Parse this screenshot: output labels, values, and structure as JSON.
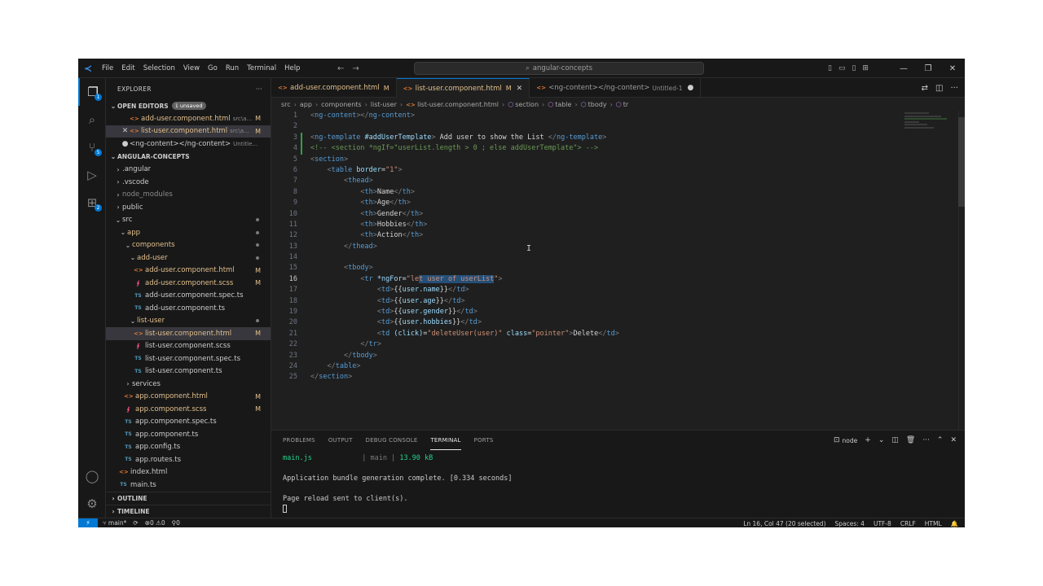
{
  "titlebar": {
    "menu": [
      "File",
      "Edit",
      "Selection",
      "View",
      "Go",
      "Run",
      "Terminal",
      "Help"
    ],
    "search_text": "angular-concepts"
  },
  "sidebar": {
    "title": "EXPLORER",
    "more": "···",
    "open_editors_label": "OPEN EDITORS",
    "unsaved_badge": "1 unsaved",
    "open_editors": [
      {
        "icon": "html",
        "name": "add-user.component.html",
        "desc": "src\\a...",
        "status": "M",
        "prefix": "none",
        "selected": false
      },
      {
        "icon": "html",
        "name": "list-user.component.html",
        "desc": "src\\a...",
        "status": "M",
        "prefix": "close",
        "selected": true
      },
      {
        "icon": "none",
        "name": "<ng-content></ng-content>",
        "desc": "Untitle...",
        "status": "",
        "prefix": "dot",
        "selected": false
      }
    ],
    "project_label": "ANGULAR-CONCEPTS",
    "tree": [
      {
        "depth": 0,
        "type": "folder",
        "open": false,
        "name": ".angular",
        "status": "",
        "mod": false,
        "selected": false
      },
      {
        "depth": 0,
        "type": "folder",
        "open": false,
        "name": ".vscode",
        "status": "",
        "mod": false,
        "selected": false
      },
      {
        "depth": 0,
        "type": "folder",
        "open": false,
        "name": "node_modules",
        "status": "",
        "mod": false,
        "selected": false,
        "dim": true
      },
      {
        "depth": 0,
        "type": "folder",
        "open": false,
        "name": "public",
        "status": "",
        "mod": false,
        "selected": false
      },
      {
        "depth": 0,
        "type": "folder",
        "open": true,
        "name": "src",
        "status": "dot",
        "mod": false,
        "selected": false
      },
      {
        "depth": 1,
        "type": "folder",
        "open": true,
        "name": "app",
        "status": "dot",
        "mod": true,
        "selected": false
      },
      {
        "depth": 2,
        "type": "folder",
        "open": true,
        "name": "components",
        "status": "dot",
        "mod": true,
        "selected": false
      },
      {
        "depth": 3,
        "type": "folder",
        "open": true,
        "name": "add-user",
        "status": "dot",
        "mod": true,
        "selected": false
      },
      {
        "depth": 4,
        "type": "html",
        "name": "add-user.component.html",
        "status": "M",
        "mod": true,
        "selected": false
      },
      {
        "depth": 4,
        "type": "scss",
        "name": "add-user.component.scss",
        "status": "M",
        "mod": true,
        "selected": false
      },
      {
        "depth": 4,
        "type": "ts",
        "name": "add-user.component.spec.ts",
        "status": "",
        "mod": false,
        "selected": false
      },
      {
        "depth": 4,
        "type": "ts",
        "name": "add-user.component.ts",
        "status": "",
        "mod": false,
        "selected": false
      },
      {
        "depth": 3,
        "type": "folder",
        "open": true,
        "name": "list-user",
        "status": "dot",
        "mod": true,
        "selected": false
      },
      {
        "depth": 4,
        "type": "html",
        "name": "list-user.component.html",
        "status": "M",
        "mod": true,
        "selected": true
      },
      {
        "depth": 4,
        "type": "scss",
        "name": "list-user.component.scss",
        "status": "",
        "mod": false,
        "selected": false
      },
      {
        "depth": 4,
        "type": "ts",
        "name": "list-user.component.spec.ts",
        "status": "",
        "mod": false,
        "selected": false
      },
      {
        "depth": 4,
        "type": "ts",
        "name": "list-user.component.ts",
        "status": "",
        "mod": false,
        "selected": false
      },
      {
        "depth": 2,
        "type": "folder",
        "open": false,
        "name": "services",
        "status": "",
        "mod": false,
        "selected": false
      },
      {
        "depth": 2,
        "type": "html",
        "name": "app.component.html",
        "status": "M",
        "mod": true,
        "selected": false
      },
      {
        "depth": 2,
        "type": "scss",
        "name": "app.component.scss",
        "status": "M",
        "mod": true,
        "selected": false
      },
      {
        "depth": 2,
        "type": "ts",
        "name": "app.component.spec.ts",
        "status": "",
        "mod": false,
        "selected": false
      },
      {
        "depth": 2,
        "type": "ts",
        "name": "app.component.ts",
        "status": "",
        "mod": false,
        "selected": false
      },
      {
        "depth": 2,
        "type": "ts",
        "name": "app.config.ts",
        "status": "",
        "mod": false,
        "selected": false
      },
      {
        "depth": 2,
        "type": "ts",
        "name": "app.routes.ts",
        "status": "",
        "mod": false,
        "selected": false
      },
      {
        "depth": 1,
        "type": "html",
        "name": "index.html",
        "status": "",
        "mod": false,
        "selected": false
      },
      {
        "depth": 1,
        "type": "ts",
        "name": "main.ts",
        "status": "",
        "mod": false,
        "selected": false
      }
    ],
    "outline_label": "OUTLINE",
    "timeline_label": "TIMELINE"
  },
  "tabs": [
    {
      "name": "add-user.component.html",
      "status": "M",
      "active": false,
      "modified": true,
      "desc": "",
      "end": "none"
    },
    {
      "name": "list-user.component.html",
      "status": "M",
      "active": true,
      "modified": true,
      "desc": "",
      "end": "close"
    },
    {
      "name": "<ng-content></ng-content>",
      "status": "",
      "active": false,
      "modified": false,
      "desc": "Untitled-1",
      "end": "dot"
    }
  ],
  "breadcrumb": [
    "src",
    "app",
    "components",
    "list-user",
    "list-user.component.html",
    "section",
    "table",
    "tbody",
    "tr"
  ],
  "editor": {
    "active_line": 16,
    "code": [
      [
        {
          "c": "t",
          "s": "<"
        },
        {
          "c": "tn",
          "s": "ng-content"
        },
        {
          "c": "t",
          "s": "></"
        },
        {
          "c": "tn",
          "s": "ng-content"
        },
        {
          "c": "t",
          "s": ">"
        }
      ],
      [],
      [
        {
          "c": "t",
          "s": "<"
        },
        {
          "c": "tn",
          "s": "ng-template"
        },
        {
          "c": "tx",
          "s": " "
        },
        {
          "c": "an",
          "s": "#addUserTemplate"
        },
        {
          "c": "t",
          "s": ">"
        },
        {
          "c": "tx",
          "s": " Add user to show the List "
        },
        {
          "c": "t",
          "s": "</"
        },
        {
          "c": "tn",
          "s": "ng-template"
        },
        {
          "c": "t",
          "s": ">"
        }
      ],
      [
        {
          "c": "cm",
          "s": "<!-- <section *ngIf=\"userList.length > 0 ; else addUserTemplate\"> -->"
        }
      ],
      [
        {
          "c": "t",
          "s": "<"
        },
        {
          "c": "tn",
          "s": "section"
        },
        {
          "c": "t",
          "s": ">"
        }
      ],
      [
        {
          "c": "tx",
          "s": "    "
        },
        {
          "c": "t",
          "s": "<"
        },
        {
          "c": "tn",
          "s": "table"
        },
        {
          "c": "tx",
          "s": " "
        },
        {
          "c": "an",
          "s": "border"
        },
        {
          "c": "tx",
          "s": "="
        },
        {
          "c": "av",
          "s": "\"1\""
        },
        {
          "c": "t",
          "s": ">"
        }
      ],
      [
        {
          "c": "tx",
          "s": "        "
        },
        {
          "c": "t",
          "s": "<"
        },
        {
          "c": "tn",
          "s": "thead"
        },
        {
          "c": "t",
          "s": ">"
        }
      ],
      [
        {
          "c": "tx",
          "s": "            "
        },
        {
          "c": "t",
          "s": "<"
        },
        {
          "c": "tn",
          "s": "th"
        },
        {
          "c": "t",
          "s": ">"
        },
        {
          "c": "tx",
          "s": "Name"
        },
        {
          "c": "t",
          "s": "</"
        },
        {
          "c": "tn",
          "s": "th"
        },
        {
          "c": "t",
          "s": ">"
        }
      ],
      [
        {
          "c": "tx",
          "s": "            "
        },
        {
          "c": "t",
          "s": "<"
        },
        {
          "c": "tn",
          "s": "th"
        },
        {
          "c": "t",
          "s": ">"
        },
        {
          "c": "tx",
          "s": "Age"
        },
        {
          "c": "t",
          "s": "</"
        },
        {
          "c": "tn",
          "s": "th"
        },
        {
          "c": "t",
          "s": ">"
        }
      ],
      [
        {
          "c": "tx",
          "s": "            "
        },
        {
          "c": "t",
          "s": "<"
        },
        {
          "c": "tn",
          "s": "th"
        },
        {
          "c": "t",
          "s": ">"
        },
        {
          "c": "tx",
          "s": "Gender"
        },
        {
          "c": "t",
          "s": "</"
        },
        {
          "c": "tn",
          "s": "th"
        },
        {
          "c": "t",
          "s": ">"
        }
      ],
      [
        {
          "c": "tx",
          "s": "            "
        },
        {
          "c": "t",
          "s": "<"
        },
        {
          "c": "tn",
          "s": "th"
        },
        {
          "c": "t",
          "s": ">"
        },
        {
          "c": "tx",
          "s": "Hobbies"
        },
        {
          "c": "t",
          "s": "</"
        },
        {
          "c": "tn",
          "s": "th"
        },
        {
          "c": "t",
          "s": ">"
        }
      ],
      [
        {
          "c": "tx",
          "s": "            "
        },
        {
          "c": "t",
          "s": "<"
        },
        {
          "c": "tn",
          "s": "th"
        },
        {
          "c": "t",
          "s": ">"
        },
        {
          "c": "tx",
          "s": "Action"
        },
        {
          "c": "t",
          "s": "</"
        },
        {
          "c": "tn",
          "s": "th"
        },
        {
          "c": "t",
          "s": ">"
        }
      ],
      [
        {
          "c": "tx",
          "s": "        "
        },
        {
          "c": "t",
          "s": "</"
        },
        {
          "c": "tn",
          "s": "thead"
        },
        {
          "c": "t",
          "s": ">"
        }
      ],
      [],
      [
        {
          "c": "tx",
          "s": "        "
        },
        {
          "c": "t",
          "s": "<"
        },
        {
          "c": "tn",
          "s": "tbody"
        },
        {
          "c": "t",
          "s": ">"
        }
      ],
      [
        {
          "c": "tx",
          "s": "            "
        },
        {
          "c": "t",
          "s": "<"
        },
        {
          "c": "tn",
          "s": "tr"
        },
        {
          "c": "tx",
          "s": " "
        },
        {
          "c": "an",
          "s": "*ngFor"
        },
        {
          "c": "tx",
          "s": "="
        },
        {
          "c": "av",
          "s": "\"le"
        },
        {
          "c": "av hl",
          "s": "t user of userList"
        },
        {
          "c": "av",
          "s": "\""
        },
        {
          "c": "t",
          "s": ">"
        }
      ],
      [
        {
          "c": "tx",
          "s": "                "
        },
        {
          "c": "t",
          "s": "<"
        },
        {
          "c": "tn",
          "s": "td"
        },
        {
          "c": "t",
          "s": ">"
        },
        {
          "c": "tx",
          "s": "{{"
        },
        {
          "c": "an",
          "s": "user.name"
        },
        {
          "c": "tx",
          "s": "}}"
        },
        {
          "c": "t",
          "s": "</"
        },
        {
          "c": "tn",
          "s": "td"
        },
        {
          "c": "t",
          "s": ">"
        }
      ],
      [
        {
          "c": "tx",
          "s": "                "
        },
        {
          "c": "t",
          "s": "<"
        },
        {
          "c": "tn",
          "s": "td"
        },
        {
          "c": "t",
          "s": ">"
        },
        {
          "c": "tx",
          "s": "{{"
        },
        {
          "c": "an",
          "s": "user.age"
        },
        {
          "c": "tx",
          "s": "}}"
        },
        {
          "c": "t",
          "s": "</"
        },
        {
          "c": "tn",
          "s": "td"
        },
        {
          "c": "t",
          "s": ">"
        }
      ],
      [
        {
          "c": "tx",
          "s": "                "
        },
        {
          "c": "t",
          "s": "<"
        },
        {
          "c": "tn",
          "s": "td"
        },
        {
          "c": "t",
          "s": ">"
        },
        {
          "c": "tx",
          "s": "{{"
        },
        {
          "c": "an",
          "s": "user.gender"
        },
        {
          "c": "tx",
          "s": "}}"
        },
        {
          "c": "t",
          "s": "</"
        },
        {
          "c": "tn",
          "s": "td"
        },
        {
          "c": "t",
          "s": ">"
        }
      ],
      [
        {
          "c": "tx",
          "s": "                "
        },
        {
          "c": "t",
          "s": "<"
        },
        {
          "c": "tn",
          "s": "td"
        },
        {
          "c": "t",
          "s": ">"
        },
        {
          "c": "tx",
          "s": "{{"
        },
        {
          "c": "an",
          "s": "user.hobbies"
        },
        {
          "c": "tx",
          "s": "}}"
        },
        {
          "c": "t",
          "s": "</"
        },
        {
          "c": "tn",
          "s": "td"
        },
        {
          "c": "t",
          "s": ">"
        }
      ],
      [
        {
          "c": "tx",
          "s": "                "
        },
        {
          "c": "t",
          "s": "<"
        },
        {
          "c": "tn",
          "s": "td"
        },
        {
          "c": "tx",
          "s": " "
        },
        {
          "c": "an",
          "s": "(click)"
        },
        {
          "c": "tx",
          "s": "="
        },
        {
          "c": "av",
          "s": "\"deleteUser(user)\""
        },
        {
          "c": "tx",
          "s": " "
        },
        {
          "c": "an",
          "s": "class"
        },
        {
          "c": "tx",
          "s": "="
        },
        {
          "c": "av",
          "s": "\"pointer\""
        },
        {
          "c": "t",
          "s": ">"
        },
        {
          "c": "tx",
          "s": "Delete"
        },
        {
          "c": "t",
          "s": "</"
        },
        {
          "c": "tn",
          "s": "td"
        },
        {
          "c": "t",
          "s": ">"
        }
      ],
      [
        {
          "c": "tx",
          "s": "            "
        },
        {
          "c": "t",
          "s": "</"
        },
        {
          "c": "tn",
          "s": "tr"
        },
        {
          "c": "t",
          "s": ">"
        }
      ],
      [
        {
          "c": "tx",
          "s": "        "
        },
        {
          "c": "t",
          "s": "</"
        },
        {
          "c": "tn",
          "s": "tbody"
        },
        {
          "c": "t",
          "s": ">"
        }
      ],
      [
        {
          "c": "tx",
          "s": "    "
        },
        {
          "c": "t",
          "s": "</"
        },
        {
          "c": "tn",
          "s": "table"
        },
        {
          "c": "t",
          "s": ">"
        }
      ],
      [
        {
          "c": "t",
          "s": "</"
        },
        {
          "c": "tn",
          "s": "section"
        },
        {
          "c": "t",
          "s": ">"
        }
      ]
    ]
  },
  "panel": {
    "tabs": [
      "PROBLEMS",
      "OUTPUT",
      "DEBUG CONSOLE",
      "TERMINAL",
      "PORTS"
    ],
    "active_tab": "TERMINAL",
    "terminal_name": "node",
    "terminal": {
      "file": "main.js",
      "chunk_name": "main",
      "size": "13.90 kB",
      "line1": "Application bundle generation complete. [0.334 seconds]",
      "line2": "Page reload sent to client(s)."
    }
  },
  "statusbar": {
    "branch": "main*",
    "errors": "0",
    "warnings": "0",
    "ports": "0",
    "position": "Ln 16, Col 47 (20 selected)",
    "spaces": "Spaces: 4",
    "encoding": "UTF-8",
    "eol": "CRLF",
    "language": "HTML"
  },
  "colors": {
    "accent": "#0078d4",
    "modified": "#e2c08d",
    "background": "#1f1f1f"
  }
}
